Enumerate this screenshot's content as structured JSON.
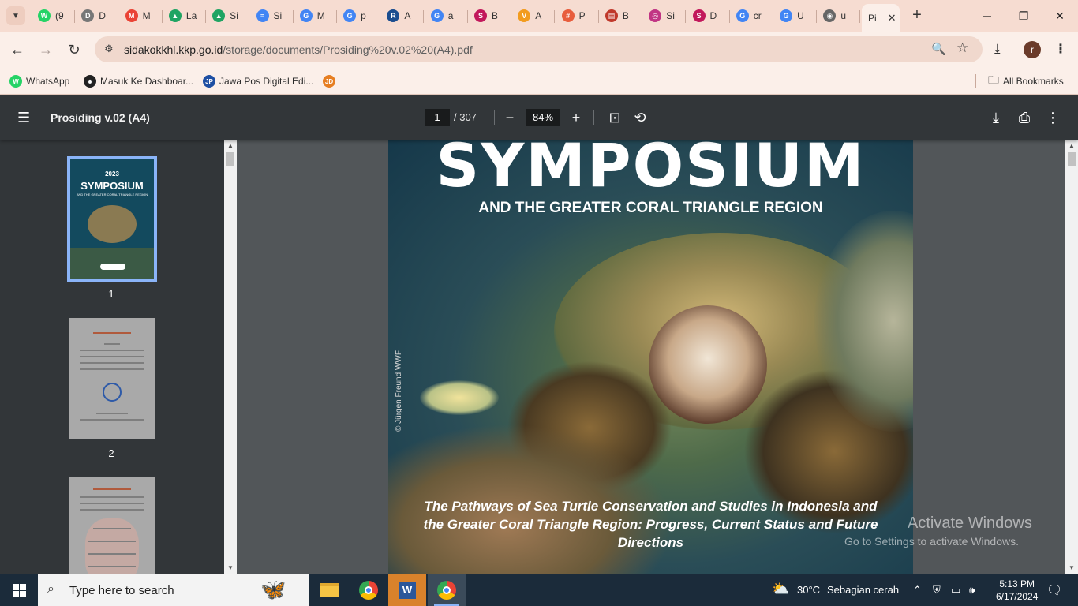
{
  "tabs": [
    {
      "short": "(9",
      "icon": "whatsapp-icon",
      "color": "#25d366",
      "glyph": "W"
    },
    {
      "short": "D",
      "icon": "tab-generic-icon",
      "color": "#777777",
      "glyph": "D"
    },
    {
      "short": "M",
      "icon": "gmail-icon",
      "color": "#ea4335",
      "glyph": "M"
    },
    {
      "short": "La",
      "icon": "drive-icon",
      "color": "#1fa463",
      "glyph": "▲"
    },
    {
      "short": "Si",
      "icon": "drive-icon",
      "color": "#1fa463",
      "glyph": "▲"
    },
    {
      "short": "Si",
      "icon": "docs-icon",
      "color": "#4285f4",
      "glyph": "≡"
    },
    {
      "short": "M",
      "icon": "google-icon",
      "color": "#4285f4",
      "glyph": "G"
    },
    {
      "short": "p",
      "icon": "google-icon",
      "color": "#4285f4",
      "glyph": "G"
    },
    {
      "short": "A",
      "icon": "tab-generic-icon",
      "color": "#1a4d8f",
      "glyph": "R"
    },
    {
      "short": "a",
      "icon": "google-icon",
      "color": "#4285f4",
      "glyph": "G"
    },
    {
      "short": "B",
      "icon": "scribd-icon",
      "color": "#c2185b",
      "glyph": "S"
    },
    {
      "short": "A",
      "icon": "tab-generic-icon",
      "color": "#f29c1f",
      "glyph": "V"
    },
    {
      "short": "P",
      "icon": "tab-generic-icon",
      "color": "#e85d3d",
      "glyph": "#"
    },
    {
      "short": "B",
      "icon": "tab-generic-icon",
      "color": "#c0392b",
      "glyph": "▤"
    },
    {
      "short": "Si",
      "icon": "instagram-icon",
      "color": "#c13584",
      "glyph": "◎"
    },
    {
      "short": "D",
      "icon": "scribd-icon",
      "color": "#c2185b",
      "glyph": "S"
    },
    {
      "short": "cr",
      "icon": "google-icon",
      "color": "#4285f4",
      "glyph": "G"
    },
    {
      "short": "U",
      "icon": "google-icon",
      "color": "#4285f4",
      "glyph": "G"
    },
    {
      "short": "u",
      "icon": "tab-generic-icon",
      "color": "#666666",
      "glyph": "◉"
    }
  ],
  "active_tab": {
    "short": "Pi",
    "close": "✕"
  },
  "window": {
    "minimize": "─",
    "maximize": "❐",
    "close": "✕",
    "new_tab": "+"
  },
  "omnibox": {
    "url_host": "sidakokkhl.kkp.go.id",
    "url_path": "/storage/documents/Prosiding%20v.02%20(A4).pdf"
  },
  "profile_initial": "r",
  "bookmarks": [
    {
      "label": "WhatsApp",
      "icon": "whatsapp-icon",
      "color": "#25d366",
      "glyph": "W"
    },
    {
      "label": "Masuk Ke Dashboar...",
      "icon": "globe-icon",
      "color": "#222222",
      "glyph": "◉"
    },
    {
      "label": "Jawa Pos Digital Edi...",
      "icon": "jawapos-icon",
      "color": "#1e4fa3",
      "glyph": "JP"
    },
    {
      "label": "",
      "icon": "jdih-icon",
      "color": "#e67e22",
      "glyph": "JD"
    }
  ],
  "all_bookmarks": "All Bookmarks",
  "pdf": {
    "title": "Prosiding v.02 (A4)",
    "current_page": "1",
    "total_pages": "/ 307",
    "zoom": "84%",
    "thumbnails": [
      "1",
      "2"
    ]
  },
  "cover": {
    "heading": "SYMPOSIUM",
    "subheading": "AND THE GREATER CORAL TRIANGLE REGION",
    "photo_credit": "© Jürgen Freund WWF",
    "subtitle": "The Pathways of Sea Turtle Conservation and Studies in Indonesia and the Greater Coral Triangle Region: Progress, Current Status and Future Directions"
  },
  "thumb1": {
    "year": "2023",
    "title": "SYMPOSIUM",
    "sub": "AND THE GREATER CORAL TRIANGLE REGION"
  },
  "watermark": {
    "line1": "Activate Windows",
    "line2": "Go to Settings to activate Windows."
  },
  "taskbar": {
    "search_placeholder": "Type here to search",
    "weather_temp": "30°C",
    "weather_text": "Sebagian cerah",
    "time": "5:13 PM",
    "date": "6/17/2024"
  }
}
